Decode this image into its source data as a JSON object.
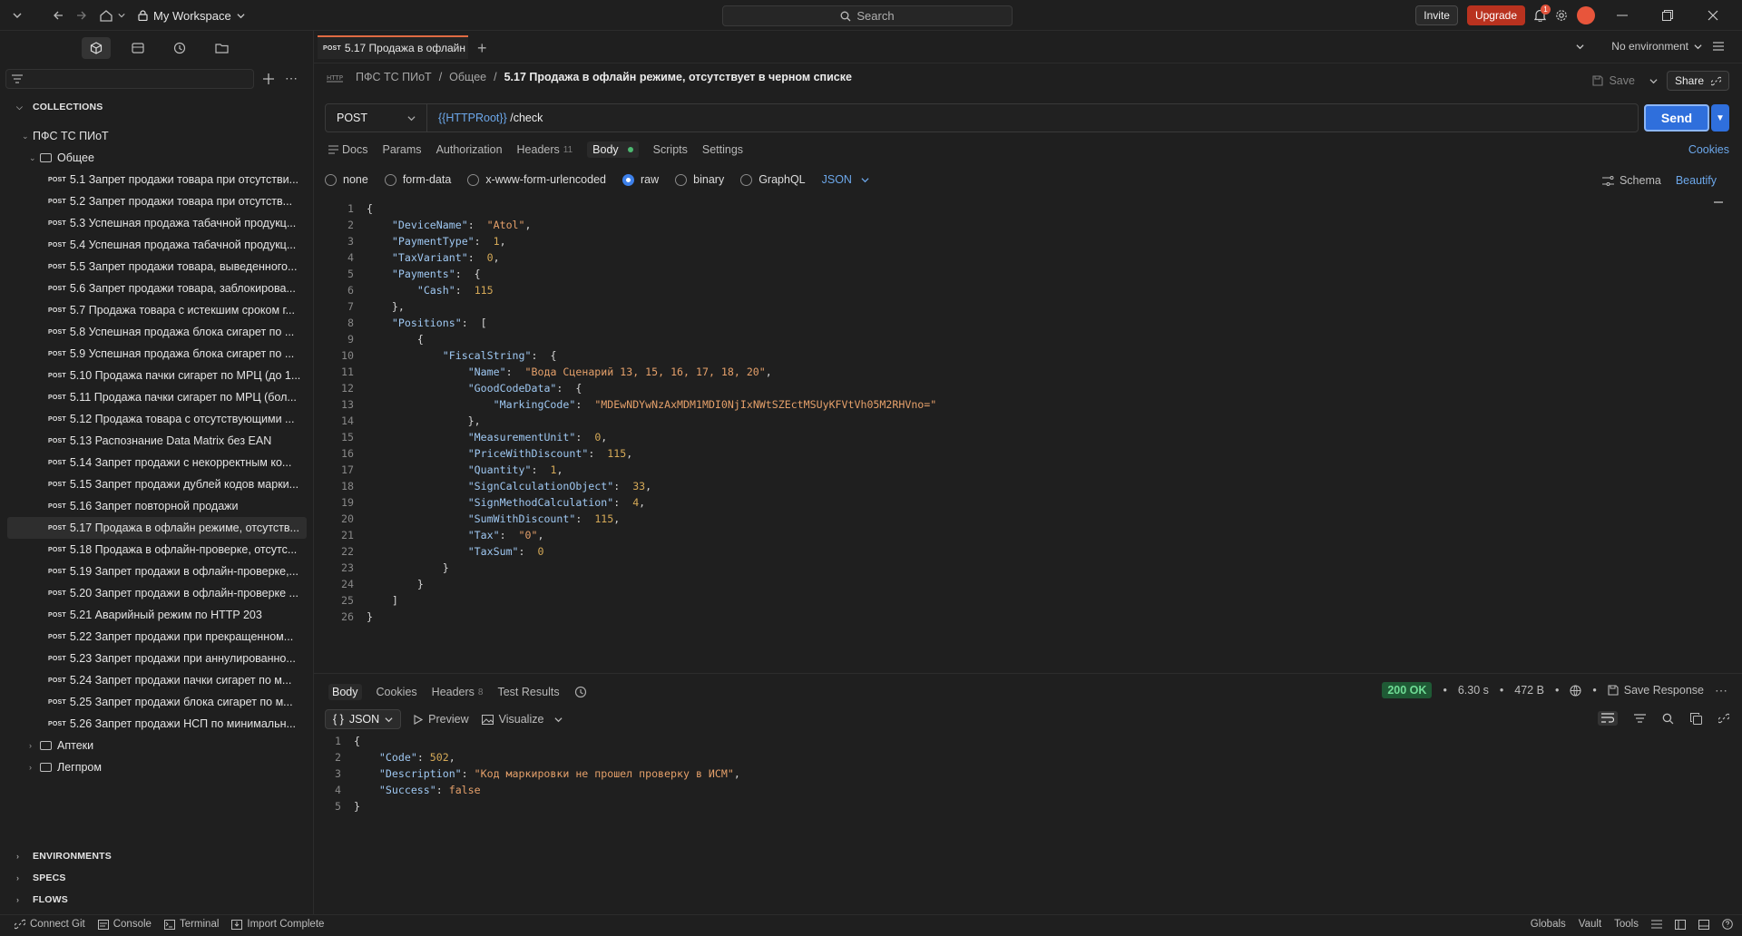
{
  "titlebar": {
    "workspace": "My Workspace",
    "search_placeholder": "Search",
    "invite": "Invite",
    "upgrade": "Upgrade",
    "notifications_count": "1"
  },
  "sidebar": {
    "collections_label": "COLLECTIONS",
    "root_collection": "ПФС ТС ПИоТ",
    "folder_open": "Общее",
    "items": [
      {
        "method": "POST",
        "label": "5.1 Запрет продажи товара при отсутстви..."
      },
      {
        "method": "POST",
        "label": "5.2 Запрет продажи товара при отсутств..."
      },
      {
        "method": "POST",
        "label": "5.3 Успешная продажа табачной продукц..."
      },
      {
        "method": "POST",
        "label": "5.4 Успешная продажа табачной продукц..."
      },
      {
        "method": "POST",
        "label": "5.5 Запрет продажи товара, выведенного..."
      },
      {
        "method": "POST",
        "label": "5.6 Запрет продажи товара, заблокирова..."
      },
      {
        "method": "POST",
        "label": "5.7 Продажа товара с истекшим сроком г..."
      },
      {
        "method": "POST",
        "label": "5.8 Успешная продажа блока сигарет по ..."
      },
      {
        "method": "POST",
        "label": "5.9 Успешная продажа блока сигарет по ..."
      },
      {
        "method": "POST",
        "label": "5.10 Продажа пачки сигарет по МРЦ (до 1..."
      },
      {
        "method": "POST",
        "label": "5.11 Продажа пачки сигарет по МРЦ (бол..."
      },
      {
        "method": "POST",
        "label": "5.12 Продажа товара с отсутствующими ..."
      },
      {
        "method": "POST",
        "label": "5.13 Распознание Data Matrix без EAN"
      },
      {
        "method": "POST",
        "label": "5.14 Запрет продажи с некорректным ко..."
      },
      {
        "method": "POST",
        "label": "5.15 Запрет продажи дублей кодов марки..."
      },
      {
        "method": "POST",
        "label": "5.16 Запрет повторной продажи"
      },
      {
        "method": "POST",
        "label": "5.17 Продажа в офлайн режиме, отсутств..."
      },
      {
        "method": "POST",
        "label": "5.18 Продажа в офлайн-проверке, отсутс..."
      },
      {
        "method": "POST",
        "label": "5.19 Запрет продажи в офлайн-проверке,..."
      },
      {
        "method": "POST",
        "label": "5.20 Запрет продажи в офлайн-проверке ..."
      },
      {
        "method": "POST",
        "label": "5.21 Аварийный режим по HTTP 203"
      },
      {
        "method": "POST",
        "label": "5.22 Запрет продажи при прекращенном..."
      },
      {
        "method": "POST",
        "label": "5.23 Запрет продажи при аннулированно..."
      },
      {
        "method": "POST",
        "label": "5.24 Запрет продажи пачки сигарет по м..."
      },
      {
        "method": "POST",
        "label": "5.25 Запрет продажи блока сигарет по м..."
      },
      {
        "method": "POST",
        "label": "5.26 Запрет продажи НСП по минимальн..."
      }
    ],
    "folders_closed": [
      "Аптеки",
      "Легпром"
    ],
    "environments_label": "ENVIRONMENTS",
    "specs_label": "SPECS",
    "flows_label": "FLOWS"
  },
  "tabbar": {
    "active_tab_method": "POST",
    "active_tab_label": "5.17 Продажа в офлайн",
    "environment": "No environment"
  },
  "breadcrumb": {
    "collection": "ПФС ТС ПИоТ",
    "folder": "Общее",
    "current": "5.17 Продажа в офлайн режиме, отсутствует в черном списке",
    "save": "Save",
    "share": "Share"
  },
  "request": {
    "method": "POST",
    "url_var": "{{HTTPRoot}}",
    "url_path": " /check",
    "send": "Send"
  },
  "request_tabs": {
    "docs": "Docs",
    "params": "Params",
    "authorization": "Authorization",
    "headers": "Headers",
    "headers_count": "11",
    "body": "Body",
    "scripts": "Scripts",
    "settings": "Settings",
    "cookies": "Cookies"
  },
  "body_types": {
    "none": "none",
    "form_data": "form-data",
    "urlencoded": "x-www-form-urlencoded",
    "raw": "raw",
    "binary": "binary",
    "graphql": "GraphQL",
    "format": "JSON",
    "schema": "Schema",
    "beautify": "Beautify"
  },
  "request_body": [
    "{",
    "    \"DeviceName\":  \"Atol\",",
    "    \"PaymentType\":  1,",
    "    \"TaxVariant\":  0,",
    "    \"Payments\":  {",
    "        \"Cash\":  115",
    "    },",
    "    \"Positions\":  [",
    "        {",
    "            \"FiscalString\":  {",
    "                \"Name\":  \"Вода Сценарий 13, 15, 16, 17, 18, 20\",",
    "                \"GoodCodeData\":  {",
    "                    \"MarkingCode\":  \"MDEwNDYwNzAxMDM1MDI0NjIxNWtSZEctMSUyKFVtVh05M2RHVno=\"",
    "                },",
    "                \"MeasurementUnit\":  0,",
    "                \"PriceWithDiscount\":  115,",
    "                \"Quantity\":  1,",
    "                \"SignCalculationObject\":  33,",
    "                \"SignMethodCalculation\":  4,",
    "                \"SumWithDiscount\":  115,",
    "                \"Tax\":  \"0\",",
    "                \"TaxSum\":  0",
    "            }",
    "        }",
    "    ]",
    "}"
  ],
  "response_tabs": {
    "body": "Body",
    "cookies": "Cookies",
    "headers": "Headers",
    "headers_count": "8",
    "test_results": "Test Results"
  },
  "response_meta": {
    "status": "200 OK",
    "time": "6.30 s",
    "size": "472 B",
    "save_response": "Save Response"
  },
  "response_tools": {
    "format": "JSON",
    "preview": "Preview",
    "visualize": "Visualize"
  },
  "response_body": [
    "{",
    "    \"Code\": 502,",
    "    \"Description\": \"Код маркировки не прошел проверку в ИСМ\",",
    "    \"Success\": false",
    "}"
  ],
  "statusbar": {
    "connect_git": "Connect Git",
    "console": "Console",
    "terminal": "Terminal",
    "import": "Import Complete",
    "globals": "Globals",
    "vault": "Vault",
    "tools": "Tools"
  }
}
